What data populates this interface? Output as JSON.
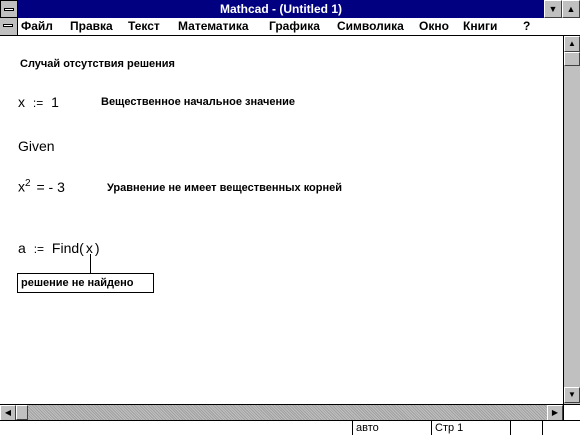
{
  "window": {
    "title": "Mathcad - (Untitled 1)"
  },
  "menu": {
    "items": [
      "Файл",
      "Правка",
      "Текст",
      "Математика",
      "Графика",
      "Символика",
      "Окно",
      "Книги",
      "?"
    ]
  },
  "worksheet": {
    "heading": "Случай отсутствия решения",
    "assign_x": {
      "var": "x",
      "op": ":=",
      "value": "1"
    },
    "assign_x_comment": "Вещественное начальное значение",
    "given": "Given",
    "equation": {
      "base": "x",
      "exp": "2",
      "rhs": "= - 3"
    },
    "equation_comment": "Уравнение не имеет вещественных корней",
    "find": {
      "var": "a",
      "op": ":=",
      "func": "Find",
      "arg": "x"
    },
    "error_message": "решение не найдено"
  },
  "statusbar": {
    "mode": "авто",
    "page": "Стр  1"
  },
  "colors": {
    "titlebar": "#000080",
    "chrome": "#c0c0c0",
    "page": "#ffffff"
  }
}
